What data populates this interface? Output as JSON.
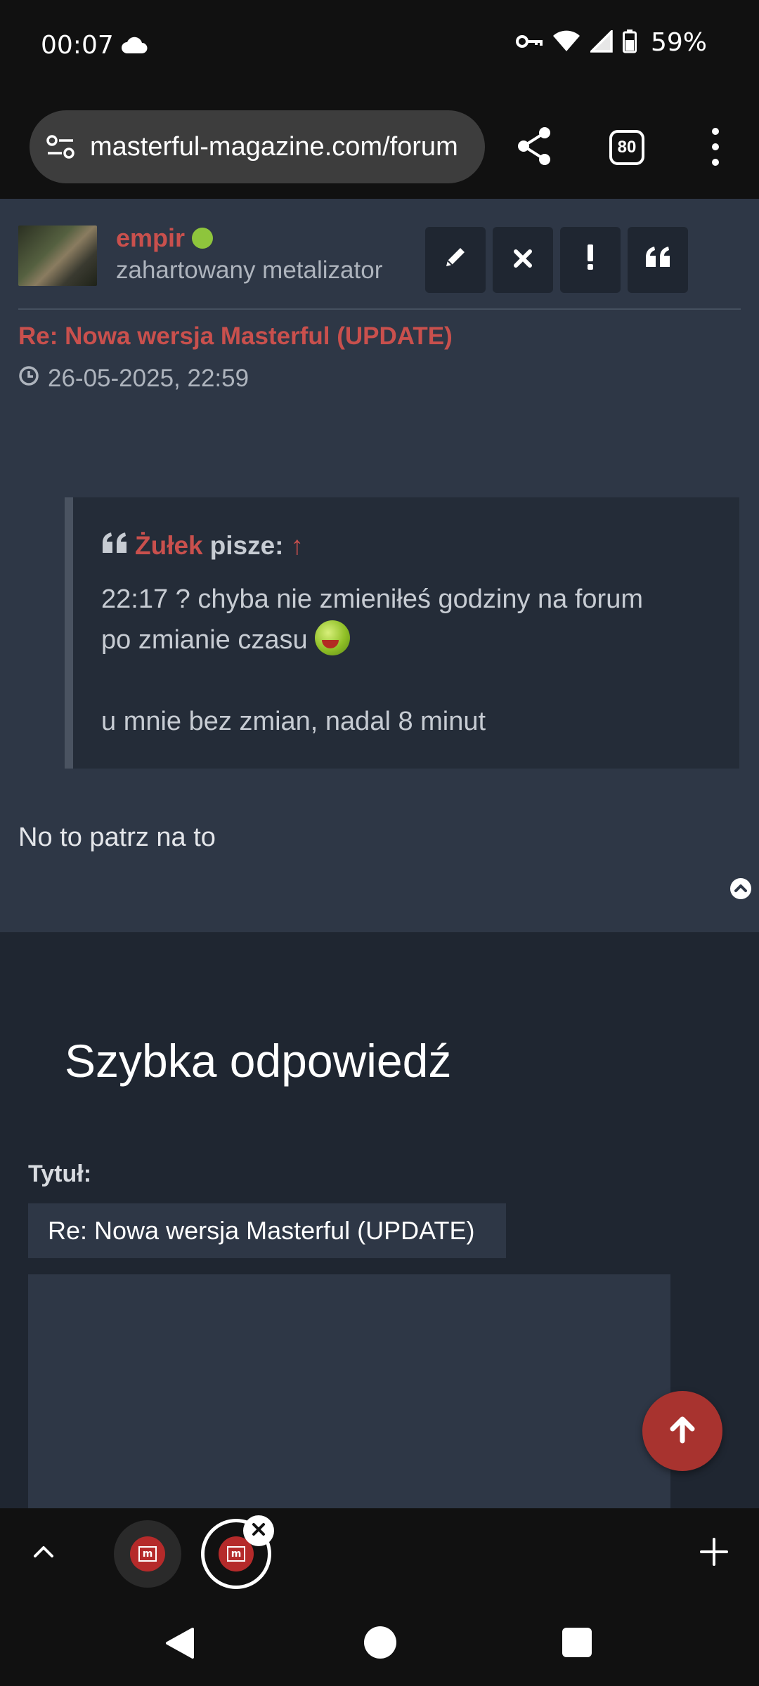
{
  "status_bar": {
    "time": "00:07",
    "battery_percent": "59%",
    "icons": [
      "cloud-icon",
      "vpn-key-icon",
      "wifi-icon",
      "signal-icon",
      "battery-icon"
    ]
  },
  "browser": {
    "url": "masterful-magazine.com/forum",
    "tab_count": "80",
    "icons": [
      "site-settings-icon",
      "share-icon",
      "tab-switcher-icon",
      "more-menu-icon"
    ]
  },
  "post": {
    "author": "empir",
    "author_online": true,
    "author_rank": "zahartowany metalizator",
    "action_icons": [
      "edit-icon",
      "delete-icon",
      "report-icon",
      "quote-icon"
    ],
    "title": "Re: Nowa wersja Masterful (UPDATE)",
    "date": "26-05-2025, 22:59",
    "quote": {
      "author": "Żułek",
      "says": "pisze:",
      "arrow": "↑",
      "line1": "22:17 ? chyba nie zmieniłeś godziny na forum",
      "line2": "po zmianie czasu",
      "line3": "u mnie bez zmian, nadal 8 minut"
    },
    "body": "No to patrz na to"
  },
  "quick_reply": {
    "heading": "Szybka odpowiedź",
    "title_label": "Tytuł:",
    "title_value": "Re: Nowa wersja Masterful (UPDATE)"
  },
  "colors": {
    "accent_red": "#c9504d",
    "online_green": "#8ec53c",
    "post_bg": "#2e3746",
    "page_bg": "#1f2631",
    "fab_red": "#a8332f"
  }
}
